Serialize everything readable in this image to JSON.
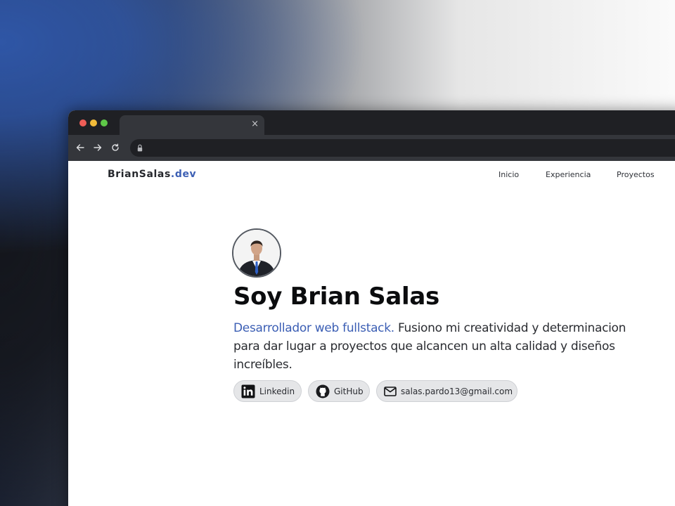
{
  "browser": {
    "tab": {
      "close_glyph": "×"
    }
  },
  "site": {
    "logo": {
      "name": "BrianSalas",
      "tld": ".dev"
    },
    "nav": {
      "inicio": "Inicio",
      "experiencia": "Experiencia",
      "proyectos": "Proyectos"
    }
  },
  "hero": {
    "headline": "Soy Brian Salas",
    "role": "Desarrollador web fullstack.",
    "description": " Fusiono mi creatividad y determinacion para dar lugar a proyectos que alcancen un alta calidad y diseños increíbles."
  },
  "social": {
    "linkedin": {
      "label": "Linkedin",
      "icon": "linkedin-icon"
    },
    "github": {
      "label": "GitHub",
      "icon": "github-icon"
    },
    "email": {
      "label": "salas.pardo13@gmail.com",
      "icon": "mail-icon"
    }
  },
  "colors": {
    "accent": "#3c5fb4",
    "browser_chrome": "#1f2024",
    "toolbar": "#34363b"
  }
}
